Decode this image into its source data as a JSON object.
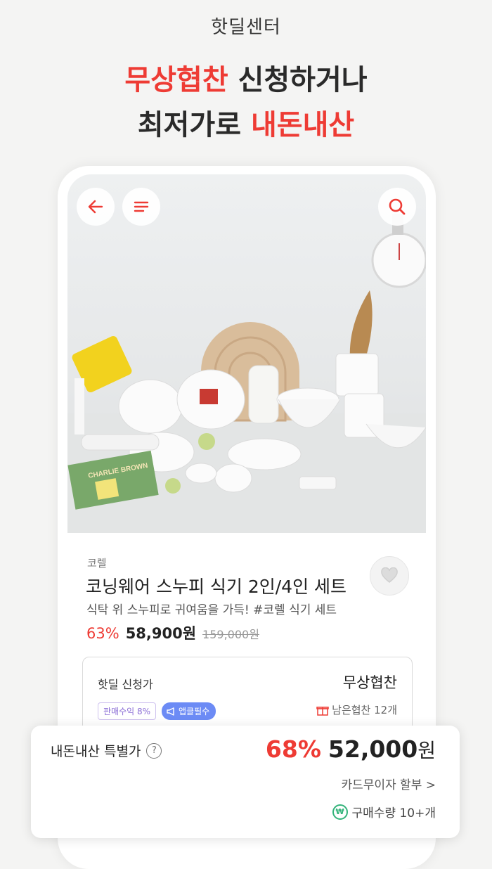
{
  "header": {
    "title": "핫딜센터",
    "headline_line1_red": "무상협찬",
    "headline_line1_rest": " 신청하거나",
    "headline_line2_rest": "최저가로 ",
    "headline_line2_red": "내돈내산"
  },
  "product": {
    "brand": "코렐",
    "name": "코닝웨어 스누피 식기 2인/4인 세트",
    "description": "식탁 위 스누피로 귀여움을 가득! #코렐 식기 세트",
    "discount": "63%",
    "price": "58,900원",
    "original_price": "159,000원",
    "image_book_text": "CHARLIE BROWN"
  },
  "apply": {
    "label": "핫딜 신청가",
    "value": "무상협찬",
    "badge_commission": "판매수익 8%",
    "badge_app_required": "앱클필수",
    "remaining": "남은협찬 12개"
  },
  "special": {
    "label": "내돈내산 특별가",
    "help": "?",
    "discount": "68%",
    "price": "52,000",
    "currency": "원",
    "installment": "카드무이자 할부 >",
    "quantity": "구매수량 10+개",
    "won_icon": "₩"
  },
  "colors": {
    "accent": "#ee3b34",
    "badge_blue": "#6c8bf5",
    "badge_purple": "#8c6fd6"
  }
}
